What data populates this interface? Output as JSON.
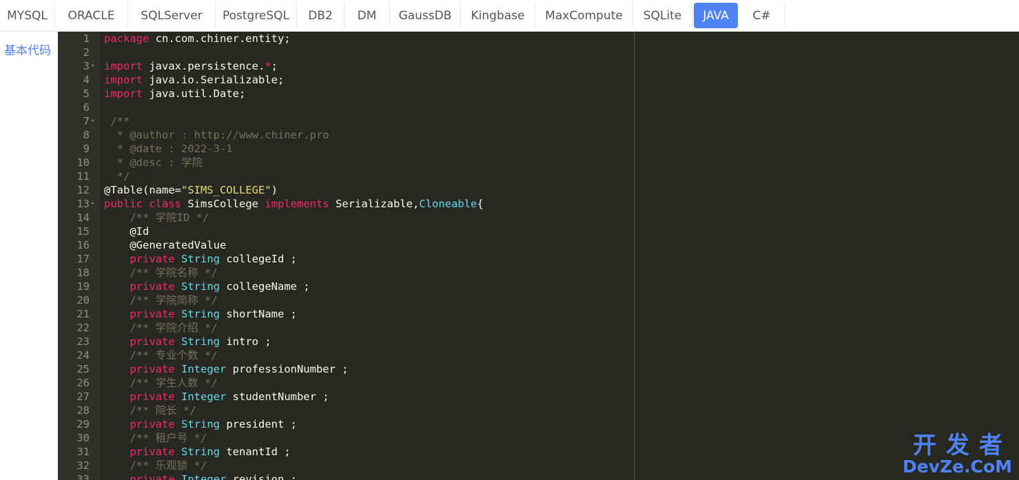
{
  "tabs": [
    {
      "label": "MYSQL",
      "active": false
    },
    {
      "label": "ORACLE",
      "active": false
    },
    {
      "label": "SQLServer",
      "active": false
    },
    {
      "label": "PostgreSQL",
      "active": false
    },
    {
      "label": "DB2",
      "active": false
    },
    {
      "label": "DM",
      "active": false
    },
    {
      "label": "GaussDB",
      "active": false
    },
    {
      "label": "Kingbase",
      "active": false
    },
    {
      "label": "MaxCompute",
      "active": false
    },
    {
      "label": "SQLite",
      "active": false
    },
    {
      "label": "JAVA",
      "active": true
    },
    {
      "label": "C#",
      "active": false
    }
  ],
  "sidebar": {
    "items": [
      {
        "label": "基本代码"
      }
    ]
  },
  "editor": {
    "fold_lines": [
      3,
      7,
      13
    ],
    "lines": [
      [
        [
          "kw",
          "package"
        ],
        [
          "pl",
          " cn.com.chiner.entity;"
        ]
      ],
      [],
      [
        [
          "kw",
          "import"
        ],
        [
          "pl",
          " javax.persistence."
        ],
        [
          "kw",
          "*"
        ],
        [
          "pl",
          ";"
        ]
      ],
      [
        [
          "kw",
          "import"
        ],
        [
          "pl",
          " java.io.Serializable;"
        ]
      ],
      [
        [
          "kw",
          "import"
        ],
        [
          "pl",
          " java.util.Date;"
        ]
      ],
      [],
      [
        [
          "cm",
          " /**"
        ]
      ],
      [
        [
          "cm",
          "  * @author : http://www.chiner.pro"
        ]
      ],
      [
        [
          "cm",
          "  * @date : 2022-3-1"
        ]
      ],
      [
        [
          "cm",
          "  * @desc : 学院"
        ]
      ],
      [
        [
          "cm",
          "  */"
        ]
      ],
      [
        [
          "pl",
          "@Table(name="
        ],
        [
          "str",
          "\"SIMS_COLLEGE\""
        ],
        [
          "pl",
          ")"
        ]
      ],
      [
        [
          "kw",
          "public"
        ],
        [
          "pl",
          " "
        ],
        [
          "kw",
          "class"
        ],
        [
          "pl",
          " SimsCollege "
        ],
        [
          "kw",
          "implements"
        ],
        [
          "pl",
          " Serializable,"
        ],
        [
          "ty",
          "Cloneable"
        ],
        [
          "pl",
          "{"
        ]
      ],
      [
        [
          "cm",
          "    /** 学院ID */"
        ]
      ],
      [
        [
          "pl",
          "    @Id"
        ]
      ],
      [
        [
          "pl",
          "    @GeneratedValue"
        ]
      ],
      [
        [
          "pl",
          "    "
        ],
        [
          "kw",
          "private"
        ],
        [
          "pl",
          " "
        ],
        [
          "ty",
          "String"
        ],
        [
          "pl",
          " collegeId ;"
        ]
      ],
      [
        [
          "cm",
          "    /** 学院名称 */"
        ]
      ],
      [
        [
          "pl",
          "    "
        ],
        [
          "kw",
          "private"
        ],
        [
          "pl",
          " "
        ],
        [
          "ty",
          "String"
        ],
        [
          "pl",
          " collegeName ;"
        ]
      ],
      [
        [
          "cm",
          "    /** 学院简称 */"
        ]
      ],
      [
        [
          "pl",
          "    "
        ],
        [
          "kw",
          "private"
        ],
        [
          "pl",
          " "
        ],
        [
          "ty",
          "String"
        ],
        [
          "pl",
          " shortName ;"
        ]
      ],
      [
        [
          "cm",
          "    /** 学院介绍 */"
        ]
      ],
      [
        [
          "pl",
          "    "
        ],
        [
          "kw",
          "private"
        ],
        [
          "pl",
          " "
        ],
        [
          "ty",
          "String"
        ],
        [
          "pl",
          " intro ;"
        ]
      ],
      [
        [
          "cm",
          "    /** 专业个数 */"
        ]
      ],
      [
        [
          "pl",
          "    "
        ],
        [
          "kw",
          "private"
        ],
        [
          "pl",
          " "
        ],
        [
          "ty",
          "Integer"
        ],
        [
          "pl",
          " professionNumber ;"
        ]
      ],
      [
        [
          "cm",
          "    /** 学生人数 */"
        ]
      ],
      [
        [
          "pl",
          "    "
        ],
        [
          "kw",
          "private"
        ],
        [
          "pl",
          " "
        ],
        [
          "ty",
          "Integer"
        ],
        [
          "pl",
          " studentNumber ;"
        ]
      ],
      [
        [
          "cm",
          "    /** 院长 */"
        ]
      ],
      [
        [
          "pl",
          "    "
        ],
        [
          "kw",
          "private"
        ],
        [
          "pl",
          " "
        ],
        [
          "ty",
          "String"
        ],
        [
          "pl",
          " president ;"
        ]
      ],
      [
        [
          "cm",
          "    /** 租户号 */"
        ]
      ],
      [
        [
          "pl",
          "    "
        ],
        [
          "kw",
          "private"
        ],
        [
          "pl",
          " "
        ],
        [
          "ty",
          "String"
        ],
        [
          "pl",
          " tenantId ;"
        ]
      ],
      [
        [
          "cm",
          "    /** 乐观锁 */"
        ]
      ],
      [
        [
          "pl",
          "    "
        ],
        [
          "kw",
          "private"
        ],
        [
          "pl",
          " "
        ],
        [
          "ty",
          "Integer"
        ],
        [
          "pl",
          " revision ;"
        ]
      ]
    ]
  },
  "watermark": {
    "cn": "开发者",
    "en": "DevZe.CoM"
  }
}
